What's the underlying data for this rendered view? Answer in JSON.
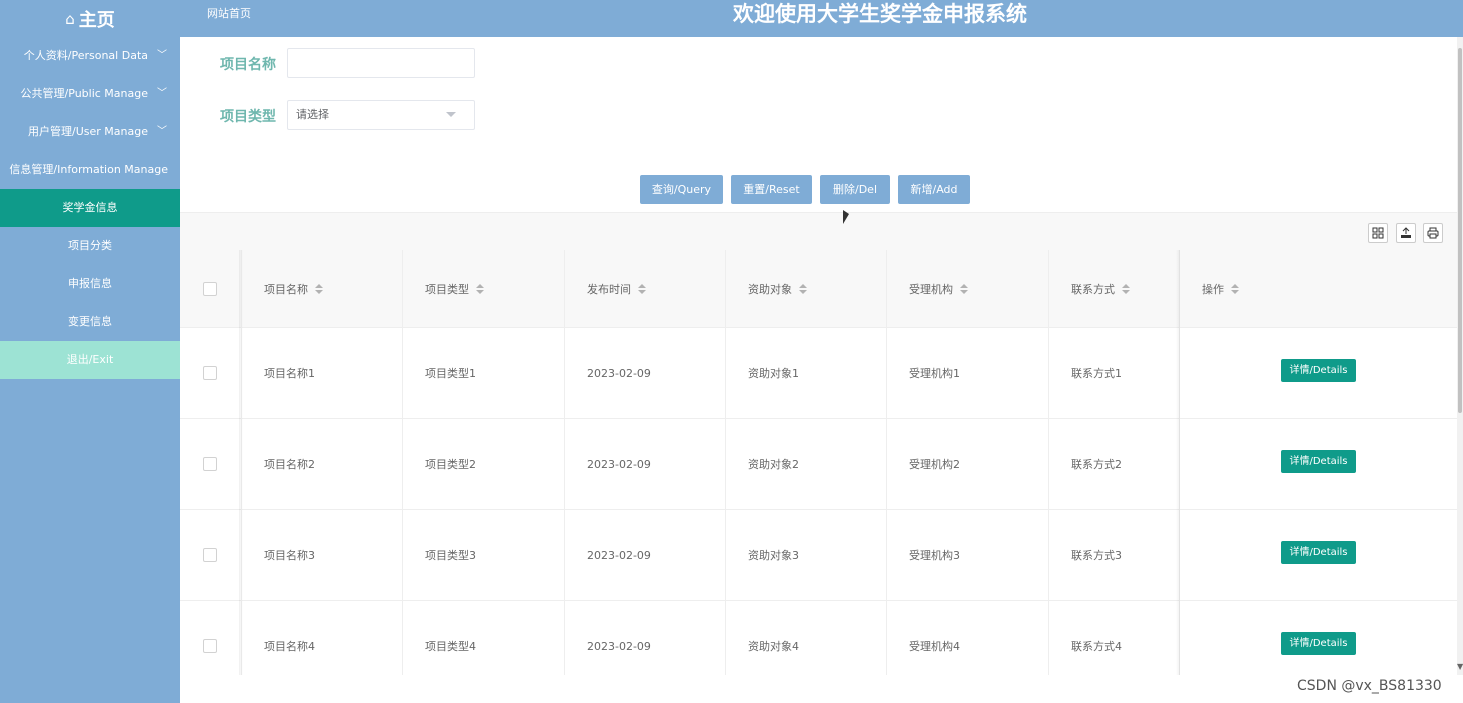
{
  "header": {
    "brand": "主页",
    "site_link": "网站首页",
    "title": "欢迎使用大学生奖学金申报系统"
  },
  "sidebar": {
    "items": [
      {
        "label": "个人资料/Personal Data"
      },
      {
        "label": "公共管理/Public Manage"
      },
      {
        "label": "用户管理/User Manage"
      },
      {
        "label": "信息管理/Information Manage"
      },
      {
        "label": "奖学金信息"
      },
      {
        "label": "项目分类"
      },
      {
        "label": "申报信息"
      },
      {
        "label": "变更信息"
      },
      {
        "label": "退出/Exit"
      }
    ]
  },
  "search": {
    "name_label": "项目名称",
    "name_value": "",
    "type_label": "项目类型",
    "type_value": "请选择"
  },
  "buttons": {
    "query": "查询/Query",
    "reset": "重置/Reset",
    "delete": "删除/Del",
    "add": "新增/Add"
  },
  "table": {
    "columns": [
      "项目名称",
      "项目类型",
      "发布时间",
      "资助对象",
      "受理机构",
      "联系方式",
      "操作"
    ],
    "rows": [
      [
        "项目名称1",
        "项目类型1",
        "2023-02-09",
        "资助对象1",
        "受理机构1",
        "联系方式1"
      ],
      [
        "项目名称2",
        "项目类型2",
        "2023-02-09",
        "资助对象2",
        "受理机构2",
        "联系方式2"
      ],
      [
        "项目名称3",
        "项目类型3",
        "2023-02-09",
        "资助对象3",
        "受理机构3",
        "联系方式3"
      ],
      [
        "项目名称4",
        "项目类型4",
        "2023-02-09",
        "资助对象4",
        "受理机构4",
        "联系方式4"
      ]
    ],
    "detail_label": "详情/Details"
  },
  "watermark": "CSDN @vx_BS81330",
  "colors": {
    "primary": "#7facd6",
    "accent": "#0f9b8a",
    "exit_bg": "#9de3d4",
    "label": "#6fb7ae"
  }
}
